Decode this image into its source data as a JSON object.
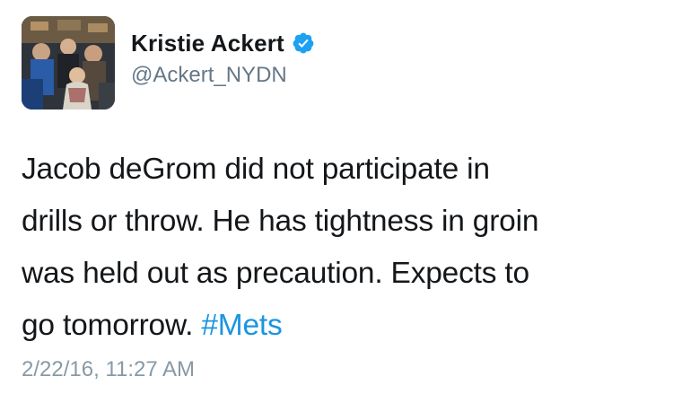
{
  "author": {
    "name": "Kristie Ackert",
    "handle": "@Ackert_NYDN",
    "verified": true,
    "avatar_icon": "profile-photo"
  },
  "tweet": {
    "lines": [
      "Jacob deGrom did not participate in",
      "drills or throw. He has tightness in groin",
      "was held out as precaution. Expects to",
      "go tomorrow. "
    ],
    "hashtag": "#Mets",
    "timestamp": "2/22/16, 11:27 AM"
  },
  "colors": {
    "hashtag": "#1b95e0",
    "verified_badge": "#1da1f2",
    "secondary_text": "#657786",
    "timestamp_text": "#8899a6"
  }
}
